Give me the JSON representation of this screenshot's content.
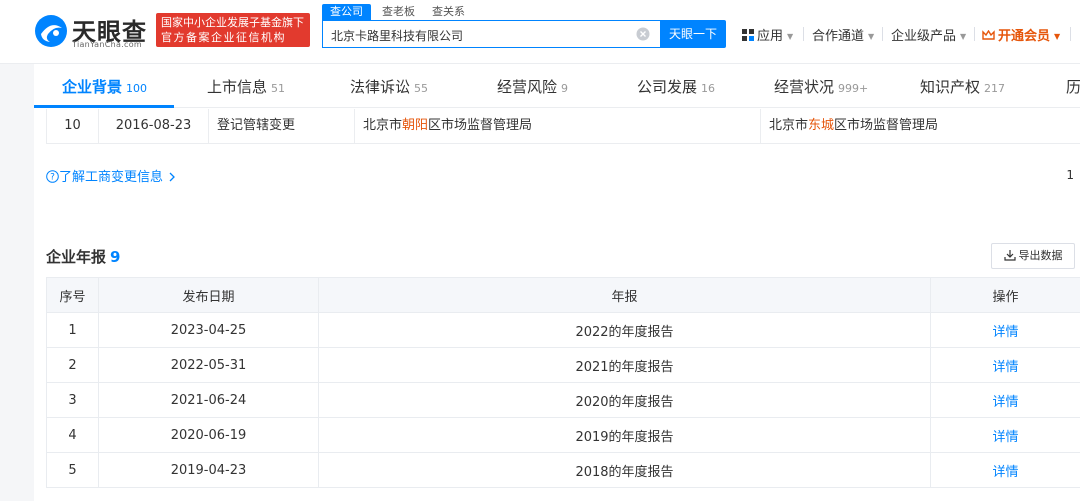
{
  "header": {
    "logo_cn": "天眼查",
    "logo_en": "TianYanCha.com",
    "slogan_line1": "国家中小企业发展子基金旗下",
    "slogan_line2": "官方备案企业征信机构",
    "search_tabs": [
      "查公司",
      "查老板",
      "查关系"
    ],
    "search_value": "北京卡路里科技有限公司",
    "search_button": "天眼一下",
    "nav": {
      "apps": "应用",
      "cooperation": "合作通道",
      "enterprise": "企业级产品",
      "vip": "开通会员"
    },
    "colors": {
      "brand": "#0084ff",
      "slogan_bg": "#e23a2e",
      "vip": "#e6560b"
    }
  },
  "tabs": [
    {
      "label": "企业背景",
      "count": "100"
    },
    {
      "label": "上市信息",
      "count": "51"
    },
    {
      "label": "法律诉讼",
      "count": "55"
    },
    {
      "label": "经营风险",
      "count": "9"
    },
    {
      "label": "公司发展",
      "count": "16"
    },
    {
      "label": "经营状况",
      "count": "999+"
    },
    {
      "label": "知识产权",
      "count": "217"
    },
    {
      "label": "历",
      "count": ""
    }
  ],
  "change_row": {
    "index": "10",
    "date": "2016-08-23",
    "item": "登记管辖变更",
    "before_a": "北京市",
    "before_hl": "朝阳",
    "before_b": "区市场监督管理局",
    "after_a": "北京市",
    "after_hl": "东城",
    "after_b": "区市场监督管理局"
  },
  "change_link": "了解工商变更信息",
  "page_number": "1",
  "annual_reports": {
    "title": "企业年报",
    "count": "9",
    "export_label": "导出数据",
    "columns": [
      "序号",
      "发布日期",
      "年报",
      "操作"
    ],
    "rows": [
      {
        "index": "1",
        "date": "2023-04-25",
        "report": "2022的年度报告",
        "action": "详情"
      },
      {
        "index": "2",
        "date": "2022-05-31",
        "report": "2021的年度报告",
        "action": "详情"
      },
      {
        "index": "3",
        "date": "2021-06-24",
        "report": "2020的年度报告",
        "action": "详情"
      },
      {
        "index": "4",
        "date": "2020-06-19",
        "report": "2019的年度报告",
        "action": "详情"
      },
      {
        "index": "5",
        "date": "2019-04-23",
        "report": "2018的年度报告",
        "action": "详情"
      }
    ]
  }
}
